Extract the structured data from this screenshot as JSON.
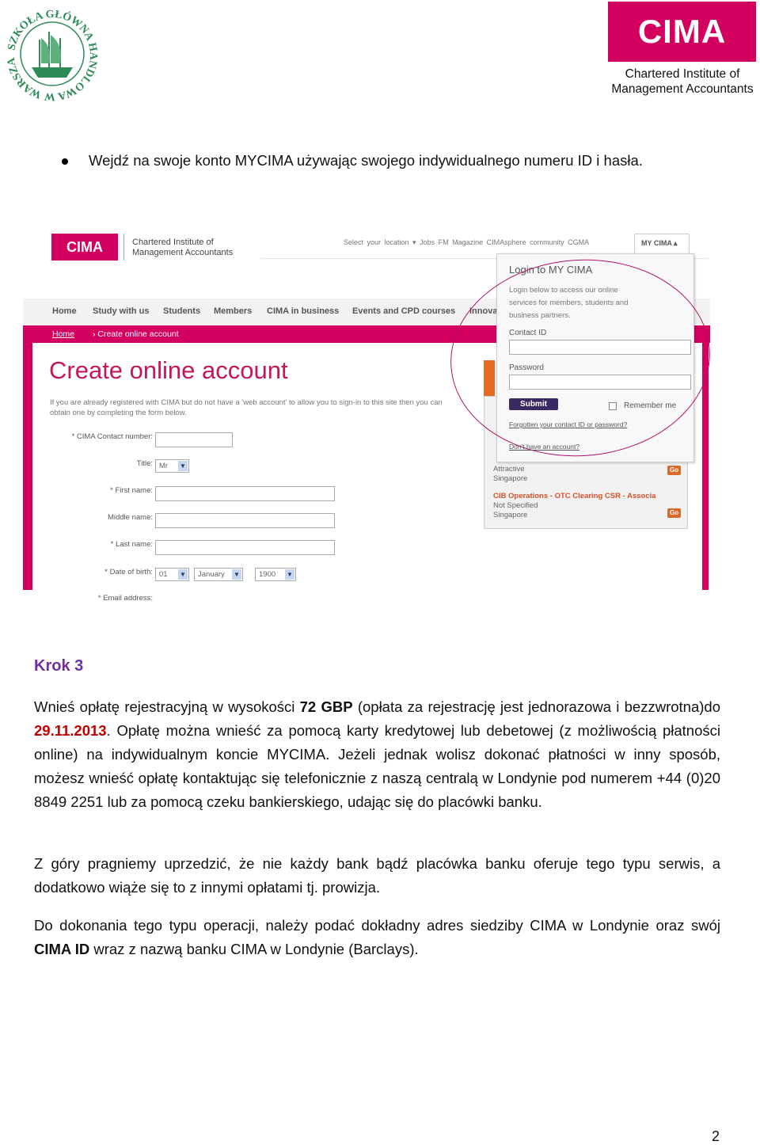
{
  "header": {
    "left_logo_text": "SZKOŁA GŁÓWNA HANDLOWA W WARSZAWIE",
    "right_logo": {
      "mark": "CIMA",
      "line1": "Chartered Institute of",
      "line2": "Management Accountants"
    }
  },
  "bullet_text": "Wejdź na swoje konto MYCIMA używając swojego indywidualnego numeru ID i hasła.",
  "screenshot": {
    "logo": "CIMA",
    "org_line1": "Chartered Institute of",
    "org_line2": "Management Accountants",
    "top_links": "Select your location ▾   Jobs   FM Magazine   CIMAsphere community   CGMA",
    "mycima_tab": "MY CIMA ▴",
    "nav": [
      "Home",
      "Study with us",
      "Students",
      "Members",
      "CIMA in business",
      "Events and CPD courses",
      "Innova"
    ],
    "breadcrumb": {
      "home": "Home",
      "current": "› Create online account"
    },
    "page_title": "Create online account",
    "intro": "If you are already registered with CIMA but do not have a 'web account' to allow you to sign-in to this site then you can obtain one by completing the form below.",
    "form": {
      "contact_label": "* CIMA Contact number:",
      "title_label": "Title:",
      "title_value": "Mr",
      "first_label": "* First name:",
      "middle_label": "Middle name:",
      "last_label": "* Last name:",
      "dob_label": "* Date of birth:",
      "dob_day": "01",
      "dob_month": "January",
      "dob_year": "1900",
      "email_label": "* Email address:"
    },
    "login": {
      "title": "Login to MY CIMA",
      "desc1": "Login below to access our online",
      "desc2": "services for members, students and",
      "desc3": "business partners.",
      "contact_label": "Contact ID",
      "password_label": "Password",
      "submit": "Submit",
      "remember": "Remember me",
      "forgot": "Forgotten your contact ID or password?",
      "no_account": "Don't have an account?"
    },
    "jobs": [
      {
        "title": "",
        "line1": "Attractive",
        "line2": "Singapore",
        "go": "Go"
      },
      {
        "title": "CIB Operations - OTC Clearing CSR - Associa",
        "line1": "Not Specified",
        "line2": "Singapore",
        "go": "Go"
      }
    ]
  },
  "step_heading": "Krok 3",
  "p1": {
    "a": "Wnieś opłatę rejestracyjną w wysokości ",
    "amount": "72 GBP",
    "b": " (opłata za rejestrację jest jednorazowa i bezzwrotna)do ",
    "date": "29.11.2013",
    "c": ". Opłatę można wnieść za pomocą karty kredytowej lub debetowej (z możliwością płatności online) na indywidualnym koncie MYCIMA. Jeżeli jednak wolisz dokonać płatności w inny sposób, możesz wnieść opłatę kontaktując się telefonicznie z naszą centralą w Londynie pod numerem +44 (0)20 8849 2251 lub za pomocą czeku bankierskiego, udając się do placówki banku."
  },
  "p2": "Z góry pragniemy uprzedzić, że nie każdy bank bądź placówka banku oferuje tego typu serwis, a dodatkowo wiąże się to z innymi opłatami tj. prowizja.",
  "p3": {
    "a": "Do dokonania tego typu operacji, należy podać dokładny adres siedziby CIMA w Londynie  oraz swój ",
    "bold": "CIMA ID",
    "b": " wraz z nazwą banku CIMA w Londynie (Barclays)."
  },
  "page_number": "2",
  "colors": {
    "cima_magenta": "#d4005f",
    "heading_purple": "#7030a0",
    "date_red": "#c00000"
  }
}
